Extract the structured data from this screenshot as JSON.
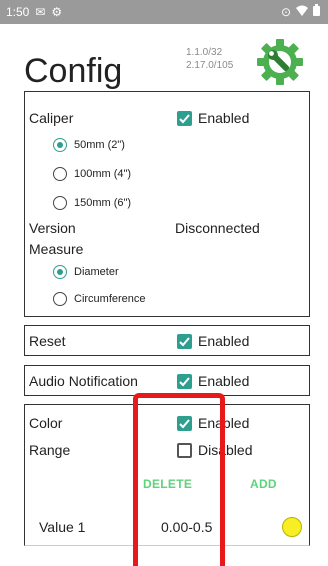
{
  "status_bar": {
    "time": "1:50",
    "icons_left": [
      "gmail-icon",
      "settings-icon"
    ],
    "icons_right": [
      "location-icon",
      "wifi-icon",
      "battery-icon"
    ]
  },
  "header": {
    "title": "Config",
    "version_1": "1.1.0/32",
    "version_2": "2.17.0/105",
    "icon": "settings-gear-wrench-icon"
  },
  "caliper": {
    "label": "Caliper",
    "enabled_label": "Enabled",
    "enabled": true,
    "sizes": [
      {
        "label": "50mm (2\")",
        "selected": true
      },
      {
        "label": "100mm (4\")",
        "selected": false
      },
      {
        "label": "150mm (6\")",
        "selected": false
      }
    ],
    "version_label": "Version",
    "version_value": "Disconnected",
    "measure_label": "Measure",
    "measure_options": [
      {
        "label": "Diameter",
        "selected": true
      },
      {
        "label": "Circumference",
        "selected": false
      }
    ]
  },
  "reset": {
    "label": "Reset",
    "enabled_label": "Enabled",
    "enabled": true
  },
  "audio": {
    "label": "Audio Notification",
    "enabled_label": "Enabled",
    "enabled": true
  },
  "color": {
    "color_label": "Color",
    "color_enabled_label": "Enabled",
    "color_enabled": true,
    "range_label": "Range",
    "range_disabled_label": "Disabled",
    "range_enabled": false,
    "delete_label": "DELETE",
    "add_label": "ADD",
    "value_label": "Value 1",
    "value_range": "0.00-0.5",
    "swatch_color": "#f7ef24"
  },
  "colors": {
    "accent": "#2e9e8f",
    "action_green": "#5fd37a",
    "overlay_red": "#e8191a"
  }
}
